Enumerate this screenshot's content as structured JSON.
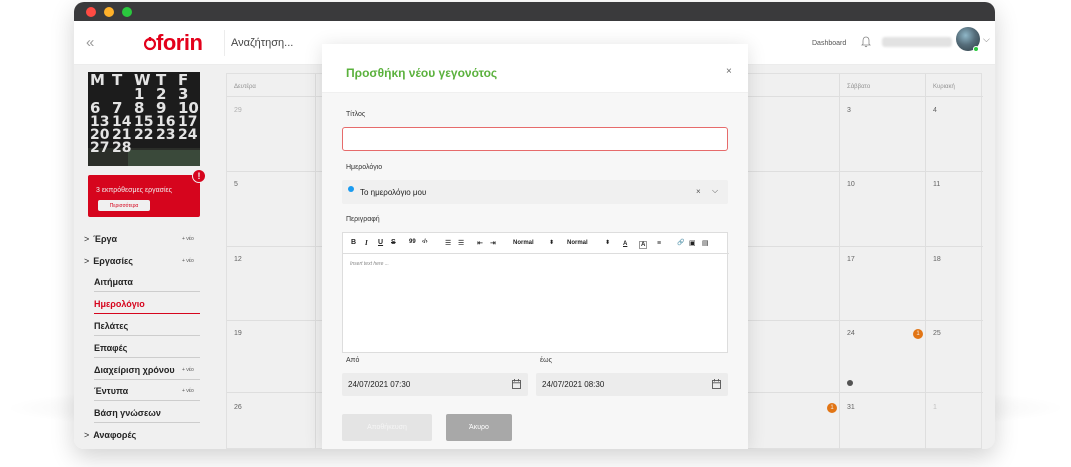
{
  "header": {
    "logo": "forin",
    "search_placeholder": "Αναζήτηση...",
    "dashboard_label": "Dashboard"
  },
  "sidebar": {
    "calendar_image": {
      "rows": [
        [
          "M",
          "T",
          "W",
          "T",
          "F"
        ],
        [
          "",
          "",
          "1",
          "2",
          "3"
        ],
        [
          "6",
          "7",
          "8",
          "9",
          "10"
        ],
        [
          "13",
          "14",
          "15",
          "16",
          "17"
        ],
        [
          "20",
          "21",
          "22",
          "23",
          "24"
        ],
        [
          "27",
          "28",
          "",
          "",
          ""
        ]
      ]
    },
    "alert": {
      "badge": "!",
      "text": "3 εκπρόθεσμες εργασίες",
      "button": "Περισσότερα"
    },
    "items": [
      {
        "label": "Έργα",
        "add": "+ νέο",
        "chevron": ">"
      },
      {
        "label": "Εργασίες",
        "add": "+ νέο",
        "chevron": ">"
      },
      {
        "label": "Αιτήματα"
      },
      {
        "label": "Ημερολόγιο",
        "active": true
      },
      {
        "label": "Πελάτες"
      },
      {
        "label": "Επαφές"
      },
      {
        "label": "Διαχείριση χρόνου",
        "add": "+ νέο"
      },
      {
        "label": "Έντυπα",
        "add": "+ νέο"
      },
      {
        "label": "Βάση γνώσεων"
      },
      {
        "label": "Αναφορές",
        "chevron": ">"
      }
    ]
  },
  "calendar": {
    "day_names": [
      "Δευτέρα",
      "Σάββατο",
      "Κυριακή"
    ],
    "rows": [
      {
        "mon": "29",
        "sat": "3",
        "sun": "4"
      },
      {
        "mon": "5",
        "sat": "10",
        "sun": "11"
      },
      {
        "mon": "12",
        "sat": "17",
        "sun": "18"
      },
      {
        "mon": "19",
        "sat": "24",
        "sun": "25"
      },
      {
        "mon": "26",
        "sat": "31",
        "sun": "1"
      }
    ],
    "badges": [
      "1",
      "1"
    ]
  },
  "modal": {
    "title": "Προσθήκη νέου γεγονότος",
    "close": "×",
    "fields": {
      "title_label": "Τίτλος",
      "title_value": "",
      "calendar_label": "Ημερολόγιο",
      "calendar_value": "Το ημερολόγιο μου",
      "description_label": "Περιγραφή",
      "description_placeholder": "Insert text here ...",
      "from_label": "Από",
      "from_value": "24/07/2021 07:30",
      "to_label": "έως",
      "to_value": "24/07/2021 08:30"
    },
    "toolbar": {
      "bold": "B",
      "italic": "I",
      "underline": "U",
      "strike": "S",
      "quote": "99",
      "code": "‹/›",
      "ordered_list": "☰",
      "bullet_list": "☰",
      "indent_left": "⇤",
      "indent_right": "⇥",
      "heading_select": "Normal",
      "size_select": "Normal",
      "updown": "⬍",
      "text_color": "A",
      "highlight": "A",
      "align": "≡",
      "link": "🔗",
      "image": "▣",
      "video": "▤"
    },
    "buttons": {
      "save": "Αποθήκευση",
      "cancel": "Άκυρο"
    }
  },
  "colors": {
    "brand_red": "#e3001b",
    "title_green": "#5ab13c",
    "calendar_dot": "#1a9bf0",
    "event_orange": "#f07a12"
  }
}
